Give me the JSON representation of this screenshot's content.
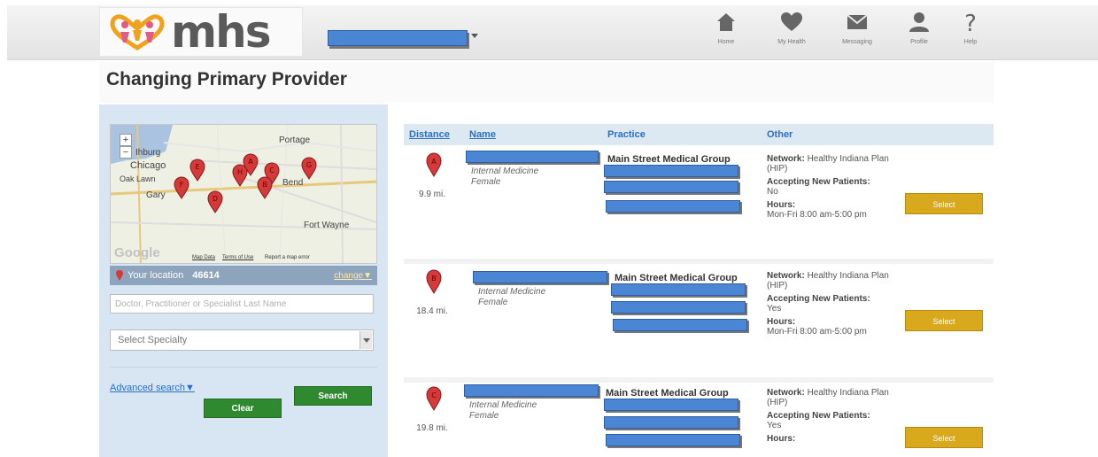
{
  "header": {
    "logo_text": "mhs",
    "nav": [
      {
        "label": "Home",
        "icon": "home-icon"
      },
      {
        "label": "My Health",
        "icon": "heart-icon"
      },
      {
        "label": "Messaging",
        "icon": "envelope-icon"
      },
      {
        "label": "Profile",
        "icon": "person-icon"
      },
      {
        "label": "Help",
        "icon": "question-icon"
      }
    ]
  },
  "page_title": "Changing Primary Provider",
  "search": {
    "map": {
      "labels": [
        "Chicago",
        "Portage",
        "Gary",
        "Fort Wayne",
        "Bend",
        "Ihburg",
        "Oak Lawn"
      ],
      "google": "Google",
      "footer": [
        "Map Data",
        "Terms of Use",
        "Report a map error"
      ],
      "markers": [
        "A",
        "B",
        "C",
        "D",
        "E",
        "F",
        "G",
        "H"
      ]
    },
    "location_label": "Your location",
    "location_zip": "46614",
    "change_link": "change▼",
    "name_placeholder": "Doctor, Practitioner or Specialist Last Name",
    "specialty_selected": "Select Specialty",
    "advanced_link": "Advanced search▼",
    "clear_button": "Clear",
    "search_button": "Search"
  },
  "results": {
    "columns": {
      "distance": "Distance",
      "name": "Name",
      "practice": "Practice",
      "other": "Other"
    },
    "rows": [
      {
        "marker": "A",
        "distance": "9.9 mi.",
        "specialty": "Internal Medicine",
        "gender": "Female",
        "practice": "Main Street Medical Group",
        "network_label": "Network:",
        "network": "Healthy Indiana Plan (HIP)",
        "accepting_label": "Accepting New Patients:",
        "accepting": "No",
        "hours_label": "Hours:",
        "hours": "Mon-Fri 8:00 am-5:00 pm",
        "select": "Select"
      },
      {
        "marker": "B",
        "distance": "18.4 mi.",
        "specialty": "Internal Medicine",
        "gender": "Female",
        "practice": "Main Street Medical Group",
        "network_label": "Network:",
        "network": "Healthy Indiana Plan (HIP)",
        "accepting_label": "Accepting New Patients:",
        "accepting": "Yes",
        "hours_label": "Hours:",
        "hours": "Mon-Fri 8:00 am-5:00 pm",
        "select": "Select"
      },
      {
        "marker": "C",
        "distance": "19.8 mi.",
        "specialty": "Internal Medicine",
        "gender": "Female",
        "practice": "Main Street Medical Group",
        "network_label": "Network:",
        "network": "Healthy Indiana Plan (HIP)",
        "accepting_label": "Accepting New Patients:",
        "accepting": "Yes",
        "hours_label": "Hours:",
        "hours": "",
        "select": "Select"
      }
    ]
  },
  "colors": {
    "accent_blue": "#2b6fc4",
    "select_gold": "#d9a91d",
    "search_green": "#2f8a2f",
    "redaction_blue": "#4a86d4"
  }
}
